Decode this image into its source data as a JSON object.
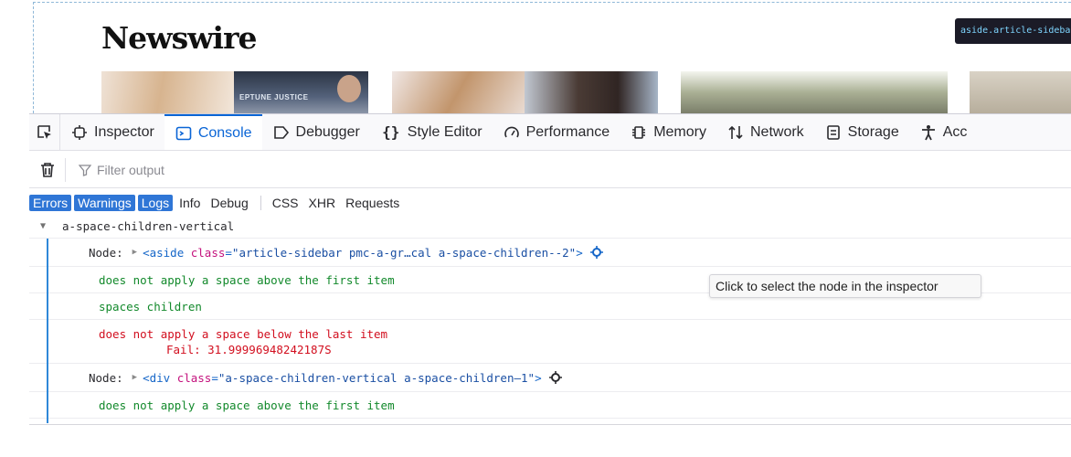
{
  "page": {
    "brand": "Newswire",
    "inspector_tooltip": "aside.article-sidebar",
    "thumb_caption": "EPTUNE JUSTICE"
  },
  "devtools": {
    "tabs": [
      {
        "label": "Inspector",
        "icon": "inspector-icon"
      },
      {
        "label": "Console",
        "icon": "console-icon",
        "active": true
      },
      {
        "label": "Debugger",
        "icon": "debugger-icon"
      },
      {
        "label": "Style Editor",
        "icon": "style-editor-icon"
      },
      {
        "label": "Performance",
        "icon": "performance-icon"
      },
      {
        "label": "Memory",
        "icon": "memory-icon"
      },
      {
        "label": "Network",
        "icon": "network-icon"
      },
      {
        "label": "Storage",
        "icon": "storage-icon"
      },
      {
        "label": "Acc",
        "icon": "accessibility-icon"
      }
    ],
    "filter_placeholder": "Filter output",
    "categories": [
      {
        "label": "Errors",
        "active": true
      },
      {
        "label": "Warnings",
        "active": true
      },
      {
        "label": "Logs",
        "active": true
      },
      {
        "label": "Info",
        "active": false
      },
      {
        "label": "Debug",
        "active": false
      },
      {
        "label": "CSS",
        "active": false
      },
      {
        "label": "XHR",
        "active": false
      },
      {
        "label": "Requests",
        "active": false
      }
    ],
    "accent_color": "#0a65d6",
    "pass_color": "#12892b",
    "fail_color": "#d20f1f"
  },
  "console": {
    "group_title": "a-space-children-vertical",
    "node_label": "Node:",
    "node1": {
      "tag_open": "<aside",
      "attr_name": "class",
      "attr_value": "\"article-sidebar pmc-a-gr…cal a-space-children--2\"",
      "tag_close": ">"
    },
    "msg_pass_first": "does not apply a space above the first item",
    "msg_pass_children": "spaces children",
    "msg_fail_last": "does not apply a space below the last item",
    "msg_fail_detail": "Fail: 31.99996948242187S",
    "node2": {
      "tag_open": "<div",
      "attr_name": "class",
      "attr_value": "\"a-space-children-vertical a-space-children—1\"",
      "tag_close": ">"
    },
    "msg_pass_first_2": "does not apply a space above the first item",
    "node_tooltip": "Click to select the node in the inspector"
  }
}
